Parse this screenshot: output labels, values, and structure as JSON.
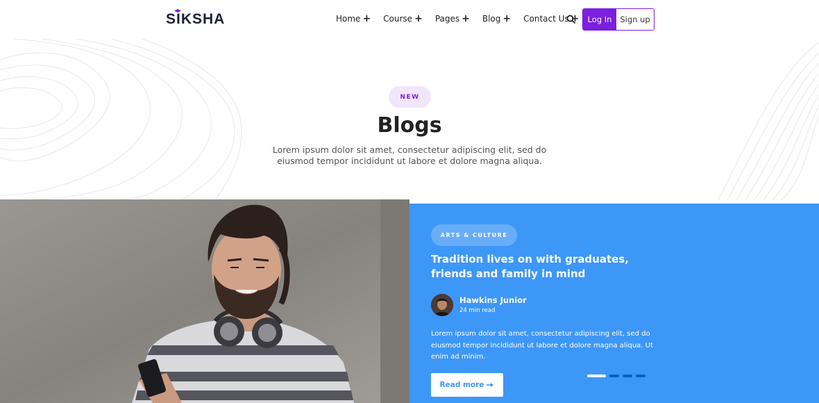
{
  "brand": {
    "name": "SIKSHA",
    "accent": "#7b1fe0",
    "logo_icon": "graduation-cap-icon"
  },
  "nav": {
    "items": [
      {
        "label": "Home",
        "suffix": "+"
      },
      {
        "label": "Course",
        "suffix": "+"
      },
      {
        "label": "Pages",
        "suffix": "+"
      },
      {
        "label": "Blog",
        "suffix": "+"
      },
      {
        "label": "Contact Us",
        "suffix": "+"
      }
    ],
    "search_icon": "search-icon",
    "login_label": "Log In",
    "signup_label": "Sign up"
  },
  "hero": {
    "badge": "NEW",
    "title": "Blogs",
    "subtitle": "Lorem ipsum dolor sit amet, consectetur adipiscing elit, sed do eiusmod tempor incididunt ut labore et dolore magna aliqua."
  },
  "post": {
    "category": "ARTS & CULTURE",
    "title": "Tradition lives on with graduates, friends and family in mind",
    "author": "Hawkins Junior",
    "read_time": "24 min read",
    "excerpt": "Lorem ipsum dolor sit amet, consectetur adipiscing elit, sed do eiusmod tempor incididunt ut labore et dolore magna aliqua. Ut enim ad minim.",
    "read_more_label": "Read more",
    "read_more_icon": "arrow-right-icon",
    "panel_color": "#3d97f7",
    "slider": {
      "total": 4,
      "active_index": 0
    }
  }
}
